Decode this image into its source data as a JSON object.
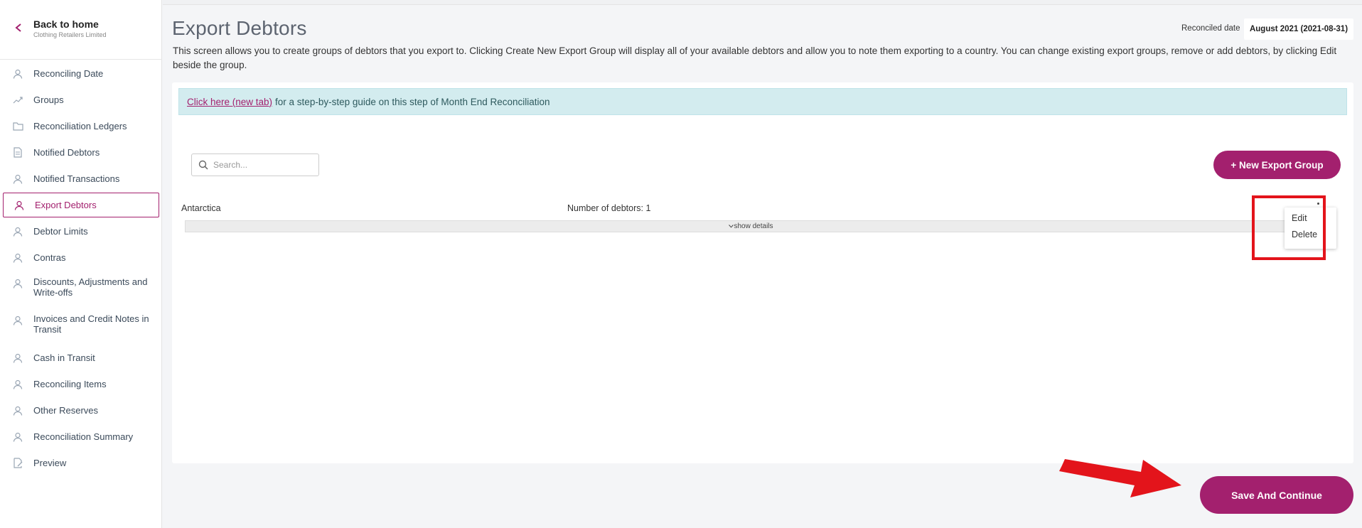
{
  "sidebar": {
    "back_title": "Back to home",
    "back_subtitle": "Clothing Retailers Limited",
    "items": [
      {
        "label": "Reconciling Date",
        "icon": "person-icon"
      },
      {
        "label": "Groups",
        "icon": "trend-icon"
      },
      {
        "label": "Reconciliation Ledgers",
        "icon": "folder-icon"
      },
      {
        "label": "Notified Debtors",
        "icon": "document-icon"
      },
      {
        "label": "Notified Transactions",
        "icon": "person-icon"
      },
      {
        "label": "Export Debtors",
        "icon": "person-icon",
        "active": true
      },
      {
        "label": "Debtor Limits",
        "icon": "person-icon"
      },
      {
        "label": "Contras",
        "icon": "person-icon"
      },
      {
        "label": "Discounts, Adjustments and Write-offs",
        "icon": "person-icon"
      },
      {
        "label": "Invoices and Credit Notes in Transit",
        "icon": "person-icon"
      },
      {
        "label": "Cash in Transit",
        "icon": "person-icon"
      },
      {
        "label": "Reconciling Items",
        "icon": "person-icon"
      },
      {
        "label": "Other Reserves",
        "icon": "person-icon"
      },
      {
        "label": "Reconciliation Summary",
        "icon": "person-icon"
      },
      {
        "label": "Preview",
        "icon": "edit-document-icon"
      }
    ]
  },
  "header": {
    "title": "Export Debtors",
    "reconciled_label": "Reconciled date",
    "reconciled_value": "August 2021 (2021-08-31)",
    "description": "This screen allows you to create groups of debtors that you export to. Clicking Create New Export Group will display all of your available debtors and allow you to note them exporting to a country. You can change existing export groups, remove or add debtors, by clicking Edit beside the group."
  },
  "info": {
    "link_text": "Click here (new tab)",
    "text": "for a step-by-step guide on this step of Month End Reconciliation"
  },
  "search": {
    "placeholder": "Search...",
    "value": ""
  },
  "new_group_button": "+ New Export Group",
  "groups": [
    {
      "name": "Antarctica",
      "count_text": "Number of debtors: 1",
      "details_label": "show details"
    }
  ],
  "context_menu": {
    "edit": "Edit",
    "delete": "Delete"
  },
  "save_button": "Save And Continue",
  "colors": {
    "accent": "#a3206e",
    "info_bg": "#d3ecef",
    "annotation_red": "#e3141b"
  }
}
